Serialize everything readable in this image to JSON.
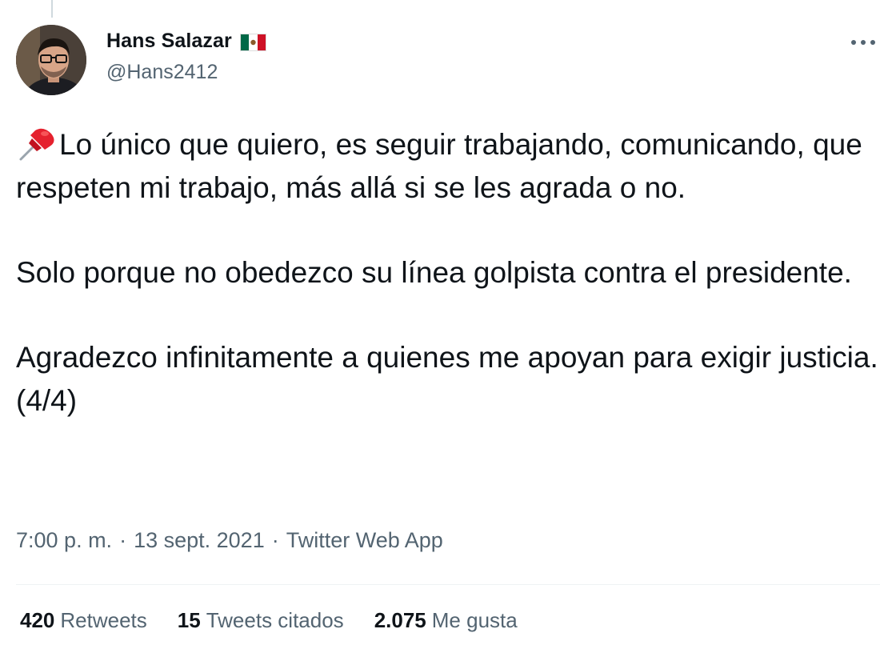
{
  "author": {
    "display_name": "Hans Salazar",
    "flag_icon": "mexico-flag-icon",
    "handle": "@Hans2412",
    "avatar_icon": "profile-photo"
  },
  "more_icon": "more-horizontal-icon",
  "tweet": {
    "pin_icon": "pushpin-emoji",
    "paragraphs": [
      "Lo único que quiero, es seguir trabajando, comunicando, que respeten mi trabajo, más allá si se les agrada o no.",
      "Solo porque no obedezco su línea golpista contra el presidente.",
      "Agradezco infinitamente a quienes me apoyan para exigir justicia.(4/4)"
    ]
  },
  "meta": {
    "time": "7:00 p. m.",
    "separator": "·",
    "date": "13 sept. 2021",
    "source": "Twitter Web App"
  },
  "stats": {
    "retweets_count": "420",
    "retweets_label": "Retweets",
    "quotes_count": "15",
    "quotes_label": "Tweets citados",
    "likes_count": "2.075",
    "likes_label": "Me gusta"
  },
  "colors": {
    "text_primary": "#0f1419",
    "text_secondary": "#536471",
    "divider": "#eff3f4"
  }
}
